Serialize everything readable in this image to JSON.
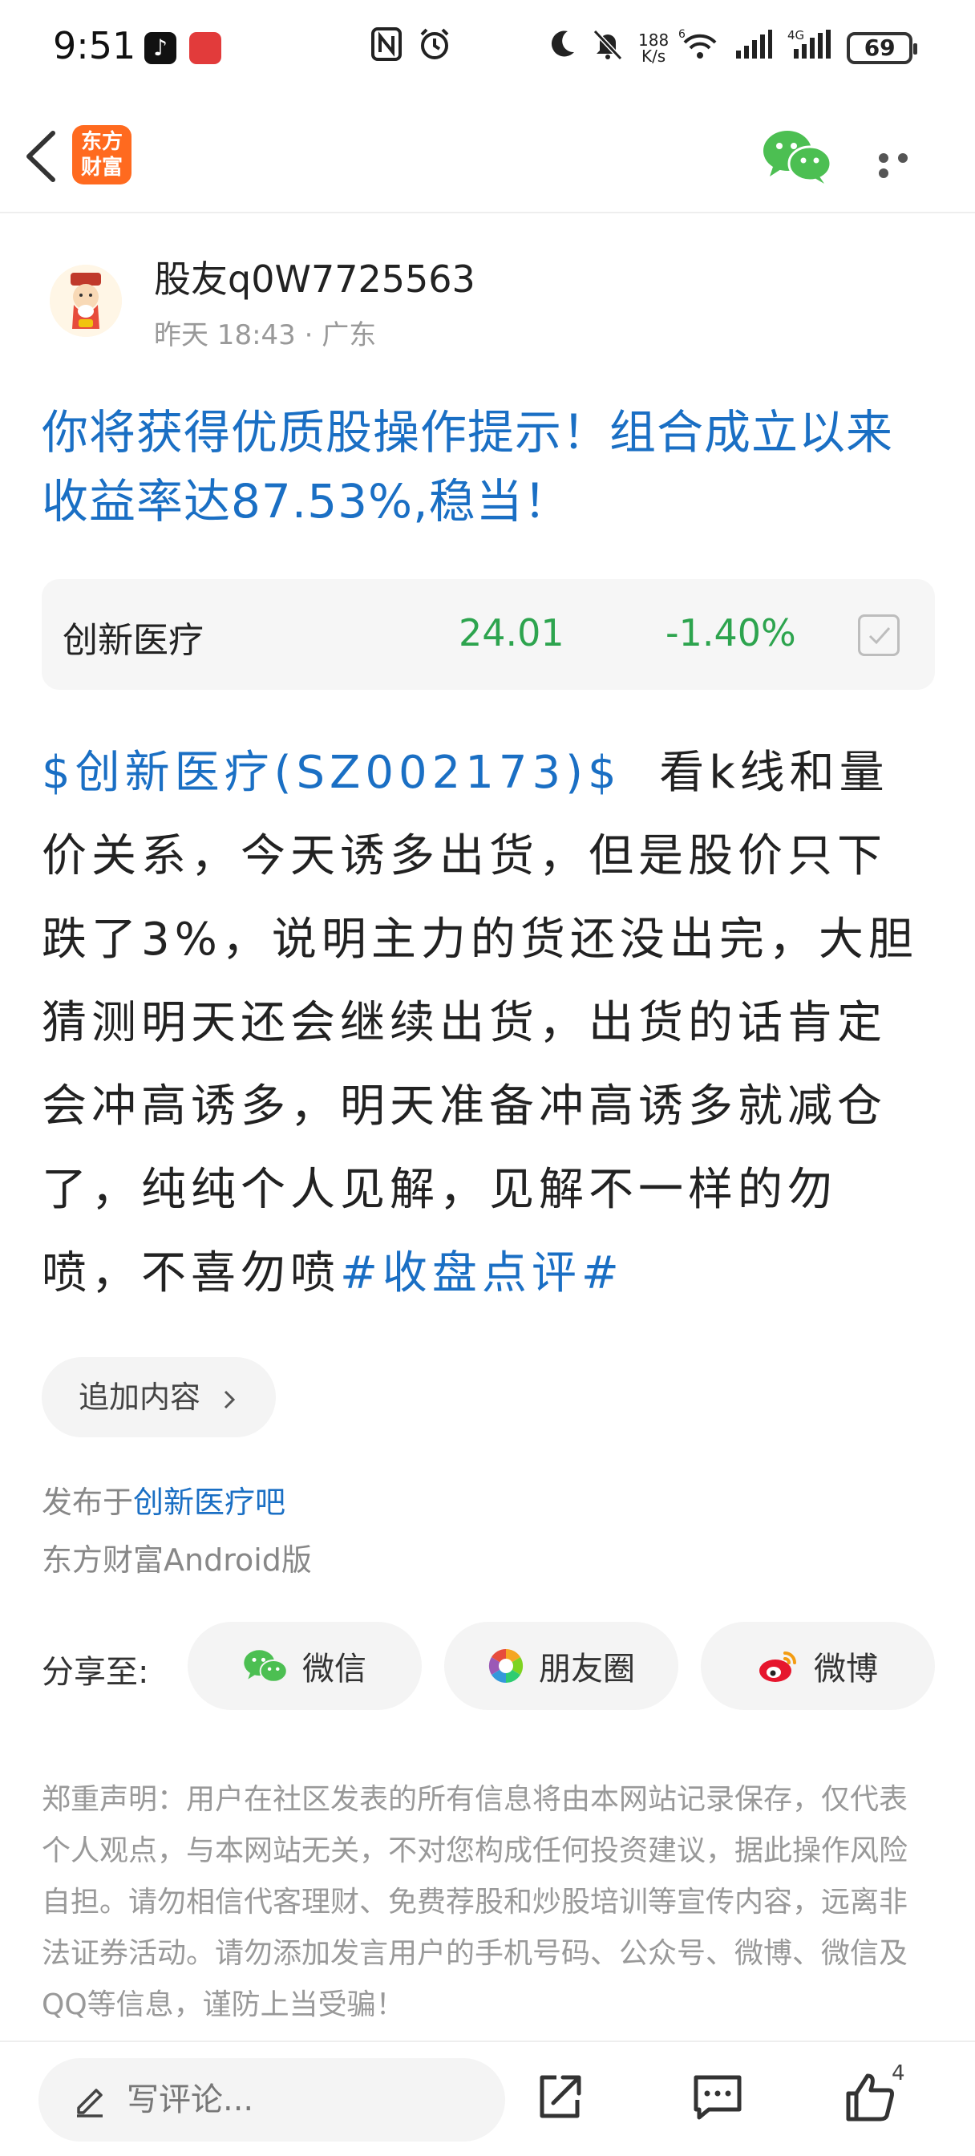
{
  "status_bar": {
    "time": "9:51",
    "net_speed_top": "188",
    "net_speed_bottom": "K/s",
    "wifi_badge": "6",
    "cell_badge": "4G",
    "battery": "69"
  },
  "header": {
    "logo_line1": "东方",
    "logo_line2": "财富"
  },
  "author": {
    "name": "股友q0W7725563",
    "time": "昨天 18:43",
    "separator": "·",
    "location": "广东"
  },
  "post": {
    "title": "你将获得优质股操作提示！组合成立以来收益率达87.53%,稳当！",
    "stock_tag": "$创新医疗(SZ002173)$",
    "body": "看k线和量价关系，今天诱多出货，但是股价只下跌了3%，说明主力的货还没出完，大胆猜测明天还会继续出货，出货的话肯定会冲高诱多，明天准备冲高诱多就减仓了，纯纯个人见解，见解不一样的勿喷，不喜勿喷",
    "hashtag": "#收盘点评#"
  },
  "stock_card": {
    "name": "创新医疗",
    "price": "24.01",
    "change": "-1.40%",
    "color_down": "#2da44e"
  },
  "append": {
    "label": "追加内容"
  },
  "meta": {
    "posted_prefix": "发布于",
    "posted_bar": "创新医疗吧",
    "client": "东方财富Android版"
  },
  "share": {
    "label": "分享至:",
    "wechat": "微信",
    "moments": "朋友圈",
    "weibo": "微博"
  },
  "disclaimer": "郑重声明：用户在社区发表的所有信息将由本网站记录保存，仅代表个人观点，与本网站无关，不对您构成任何投资建议，据此操作风险自担。请勿相信代客理财、免费荐股和炒股培训等宣传内容，远离非法证券活动。请勿添加发言用户的手机号码、公众号、微博、微信及QQ等信息，谨防上当受骗！",
  "bottom_bar": {
    "comment_placeholder": "写评论...",
    "like_count": "4"
  },
  "colors": {
    "link_blue": "#1a6fc4",
    "brand_orange": "#ff6a1f",
    "wechat_green": "#4cbf52"
  }
}
